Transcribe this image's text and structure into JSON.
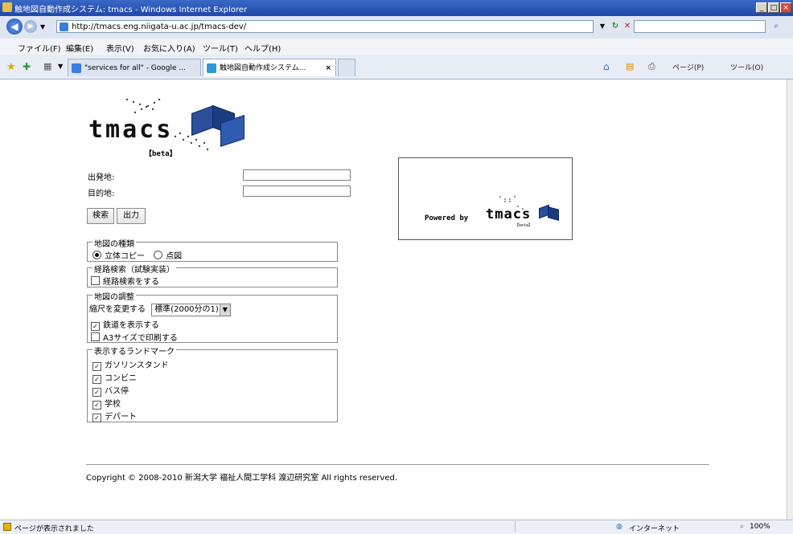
{
  "window": {
    "title": "触地図自動作成システム: tmacs - Windows Internet Explorer",
    "min": "_",
    "max": "□",
    "close": "×"
  },
  "address": {
    "back": "◀",
    "forward": "▶",
    "url": "http://tmacs.eng.niigata-u.ac.jp/tmacs-dev/",
    "search_value": "",
    "search_icon": "search-icon"
  },
  "menu": [
    "ファイル(F)",
    "編集(E)",
    "表示(V)",
    "お気に入り(A)",
    "ツール(T)",
    "ヘルプ(H)"
  ],
  "tabs": [
    {
      "label": "\"services for all\" - Google ..."
    },
    {
      "label": "触地図自動作成システム..."
    }
  ],
  "tab_close": "×",
  "command_bar": [
    "ページ(P)",
    "ツール(O)"
  ],
  "page": {
    "logo_text": "tmacs",
    "logo_beta": "【beta】",
    "origin_label": "出発地:",
    "destination_label": "目的地:",
    "origin_value": "",
    "destination_value": "",
    "search_button": "検索",
    "output_button": "出力",
    "map_type": {
      "legend": "地図の種類",
      "options": [
        {
          "label": "立体コピー",
          "selected": true
        },
        {
          "label": "点図",
          "selected": false
        }
      ]
    },
    "route_search": {
      "legend": "経路検索（試験実装）",
      "checkbox": {
        "label": "経路検索をする",
        "checked": false
      }
    },
    "map_adjust": {
      "legend": "地図の調整",
      "scale_label": "縮尺を変更する",
      "scale_value": "標準(2000分の1)",
      "rail": {
        "label": "鉄道を表示する",
        "checked": true
      },
      "a3": {
        "label": "A3サイズで印刷する",
        "checked": false
      }
    },
    "landmarks": {
      "legend": "表示するランドマーク",
      "items": [
        {
          "label": "ガソリンスタンド",
          "checked": true
        },
        {
          "label": "コンビニ",
          "checked": true
        },
        {
          "label": "バス停",
          "checked": true
        },
        {
          "label": "学校",
          "checked": true
        },
        {
          "label": "デパート",
          "checked": true
        }
      ]
    },
    "powered_by": "Powered by",
    "powered_logo": "tmacs",
    "powered_beta": "【beta】",
    "copyright": "Copyright © 2008-2010 新潟大学 福祉人間工学科 渡辺研究室 All rights reserved."
  },
  "status": {
    "text": "ページが表示されました",
    "zone": "インターネット",
    "zoom": "100%"
  }
}
